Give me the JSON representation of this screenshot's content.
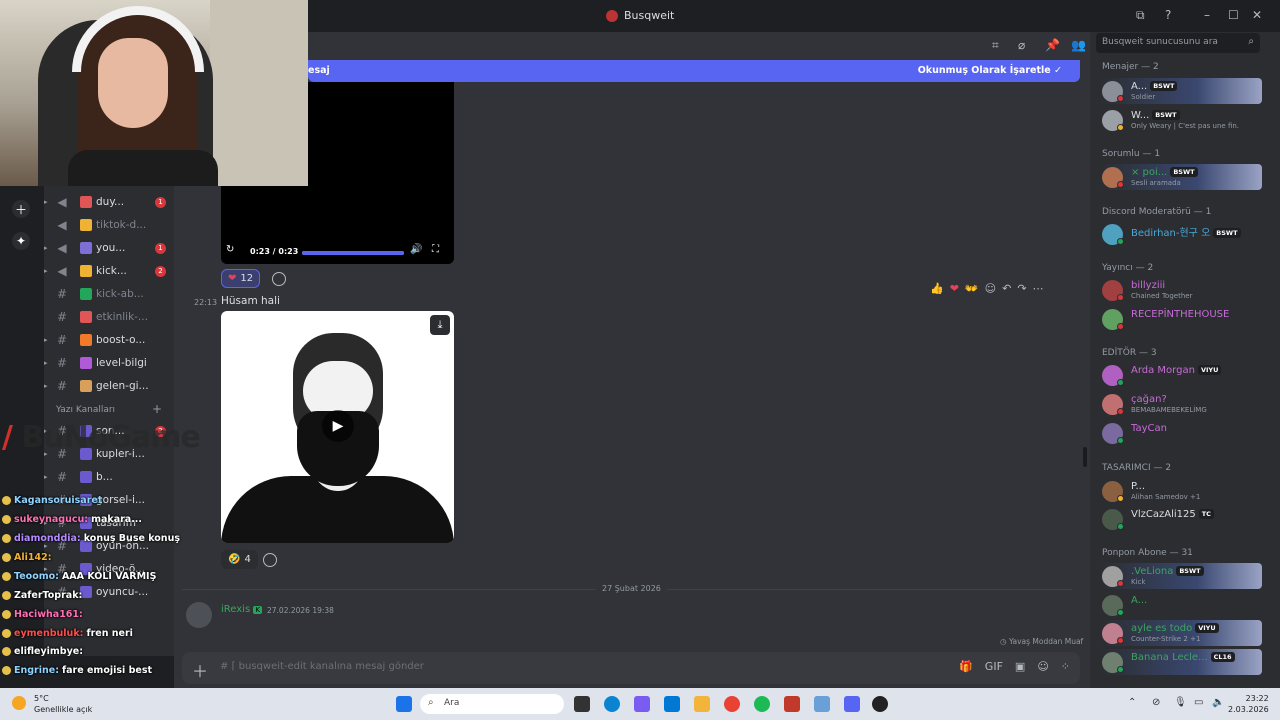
{
  "window": {
    "title": "Busqweit"
  },
  "header_icons": [
    "threads-icon",
    "mute-icon",
    "pin-icon",
    "members-icon"
  ],
  "unread_bar": {
    "left_text": "esaj",
    "right_text": "Okunmuş Olarak İşaretle"
  },
  "video_top": {
    "time": "0:23 / 0:23",
    "progress": 1.0
  },
  "reactions_top": [
    {
      "emoji": "❤",
      "count": "12"
    }
  ],
  "message": {
    "time": "22:13",
    "text": "Hüsam hali"
  },
  "reactions_bottom": [
    {
      "emoji": "🤣",
      "count": "4"
    }
  ],
  "date_divider": "27 Şubat 2026",
  "next_message": {
    "author": "iRexis",
    "time": "27.02.2026 19:38"
  },
  "typing": "Yavaş Moddan Muaf",
  "composer": {
    "placeholder": "busqweit-edit kanalına mesaj gönder"
  },
  "channels": {
    "items": [
      {
        "name": "duy...",
        "badge": "1",
        "muted": false,
        "type": "voice",
        "color": "#e05555"
      },
      {
        "name": "tiktok-d...",
        "badge": "",
        "muted": true,
        "type": "voice",
        "color": "#f0b232"
      },
      {
        "name": "you...",
        "badge": "1",
        "muted": false,
        "type": "voice",
        "color": "#7c6fd6"
      },
      {
        "name": "kick...",
        "badge": "2",
        "muted": false,
        "type": "voice",
        "color": "#f0b232"
      },
      {
        "name": "kick-ab...",
        "badge": "",
        "muted": true,
        "type": "text",
        "color": "#23a55a"
      },
      {
        "name": "etkinlik-...",
        "badge": "",
        "muted": true,
        "type": "text",
        "color": "#e05555"
      },
      {
        "name": "boost-o...",
        "badge": "",
        "muted": false,
        "type": "text",
        "color": "#f07a2a"
      },
      {
        "name": "level-bilgi",
        "badge": "",
        "muted": false,
        "type": "text",
        "color": "#b05ad8"
      },
      {
        "name": "gelen-gi...",
        "badge": "",
        "muted": false,
        "type": "text",
        "color": "#d8a05a"
      }
    ],
    "category": "Yazı Kanalları",
    "lower": [
      {
        "name": "son...",
        "badge": "2"
      },
      {
        "name": "kupler-i...",
        "badge": ""
      },
      {
        "name": "b...",
        "badge": ""
      },
      {
        "name": "gorsel-i...",
        "badge": ""
      },
      {
        "name": "tasarim",
        "badge": ""
      },
      {
        "name": "oyun-ön...",
        "badge": ""
      },
      {
        "name": "video-ö...",
        "badge": ""
      },
      {
        "name": "oyuncu-...",
        "badge": ""
      }
    ]
  },
  "overlay": {
    "brand": "BuNoGame",
    "lines": [
      {
        "user": "Kagansoruisaret",
        "text": "",
        "color": "#8fd3ff"
      },
      {
        "user": "sukeynagucu:",
        "text": "makara...",
        "color": "#ff6fb5"
      },
      {
        "user": "diamonddia:",
        "text": "konuş Buse konuş",
        "color": "#b58cff"
      },
      {
        "user": "Ali142:",
        "text": "",
        "color": "#f0b232"
      },
      {
        "user": "Teoomo:",
        "text": "AAA KOLİ VARMIŞ",
        "color": "#8fd3ff"
      },
      {
        "user": "ZaferToprak:",
        "text": "",
        "color": "#ffffff"
      },
      {
        "user": "Haciwha161:",
        "text": "",
        "color": "#ff6fb5"
      },
      {
        "user": "eymenbuluk:",
        "text": "fren neri",
        "color": "#ff4d4d"
      },
      {
        "user": "elifleyimbye:",
        "text": "",
        "color": "#ffffff"
      },
      {
        "user": "Engrine:",
        "text": "fare emojisi best",
        "color": "#8fd3ff"
      }
    ]
  },
  "search": {
    "placeholder": "Busqweit sunucusunu ara"
  },
  "members": {
    "roles": [
      {
        "label": "Menajer — 2"
      },
      {
        "label": "Sorumlu — 1"
      },
      {
        "label": "Discord Moderatörü — 1"
      },
      {
        "label": "Yayıncı — 2"
      },
      {
        "label": "EDİTÖR — 3"
      },
      {
        "label": "TASARIMCI — 2"
      },
      {
        "label": "Ponpon Abone — 31"
      }
    ],
    "list": [
      {
        "name": "A...",
        "tag": "BSWT",
        "sub": "Soldier",
        "color": "#dbdee1",
        "status": "dnd",
        "banner": true
      },
      {
        "name": "W...",
        "tag": "BSWT",
        "sub": "Only Weary | C'est pas une fin.",
        "color": "#dbdee1",
        "status": "idle",
        "banner": false
      },
      {
        "name": "× poi...",
        "tag": "BSWT",
        "sub": "Sesli aramada",
        "color": "#3ba55d",
        "status": "dnd",
        "banner": true
      },
      {
        "name": "Bedirhan-현구 오",
        "tag": "BSWT",
        "sub": "",
        "color": "#4aa8d8",
        "status": "on",
        "banner": false
      },
      {
        "name": "billyziii",
        "tag": "",
        "sub": "Chained Together",
        "color": "#c86bd8",
        "status": "dnd",
        "banner": false
      },
      {
        "name": "RECEPİNTHEHOUSE",
        "tag": "",
        "sub": "",
        "color": "#c86bd8",
        "status": "dnd",
        "banner": false
      },
      {
        "name": "Arda Morgan",
        "tag": "VIYU",
        "sub": "",
        "color": "#c86bd8",
        "status": "on",
        "banner": false
      },
      {
        "name": "çağan?",
        "tag": "",
        "sub": "BEMABAMEBEKELİMG",
        "color": "#c86bd8",
        "status": "dnd",
        "banner": false
      },
      {
        "name": "TayCan",
        "tag": "",
        "sub": "",
        "color": "#c86bd8",
        "status": "on",
        "banner": false
      },
      {
        "name": "P...",
        "tag": "",
        "sub": "Alihan Samedov +1",
        "color": "#dbdee1",
        "status": "idle",
        "banner": false
      },
      {
        "name": "VlzCazAli125",
        "tag": "TC",
        "sub": "",
        "color": "#dbdee1",
        "status": "on",
        "banner": false
      },
      {
        "name": ".VeLiona",
        "tag": "BSWT",
        "sub": "Kick",
        "color": "#3ba55d",
        "status": "dnd",
        "banner": true
      },
      {
        "name": "A...",
        "tag": "",
        "sub": "",
        "color": "#3ba55d",
        "status": "on",
        "banner": false
      },
      {
        "name": "ayle es todo",
        "tag": "VIYU",
        "sub": "Counter-Strike 2 +1",
        "color": "#3ba55d",
        "status": "dnd",
        "banner": true
      },
      {
        "name": "Banana Lecle...",
        "tag": "CL16",
        "sub": "",
        "color": "#3ba55d",
        "status": "on",
        "banner": true
      }
    ]
  },
  "taskbar": {
    "weather_temp": "5°C",
    "weather_desc": "Genellikle açık",
    "search_label": "Ara",
    "time": "23:22",
    "date": "2.03.2026"
  }
}
